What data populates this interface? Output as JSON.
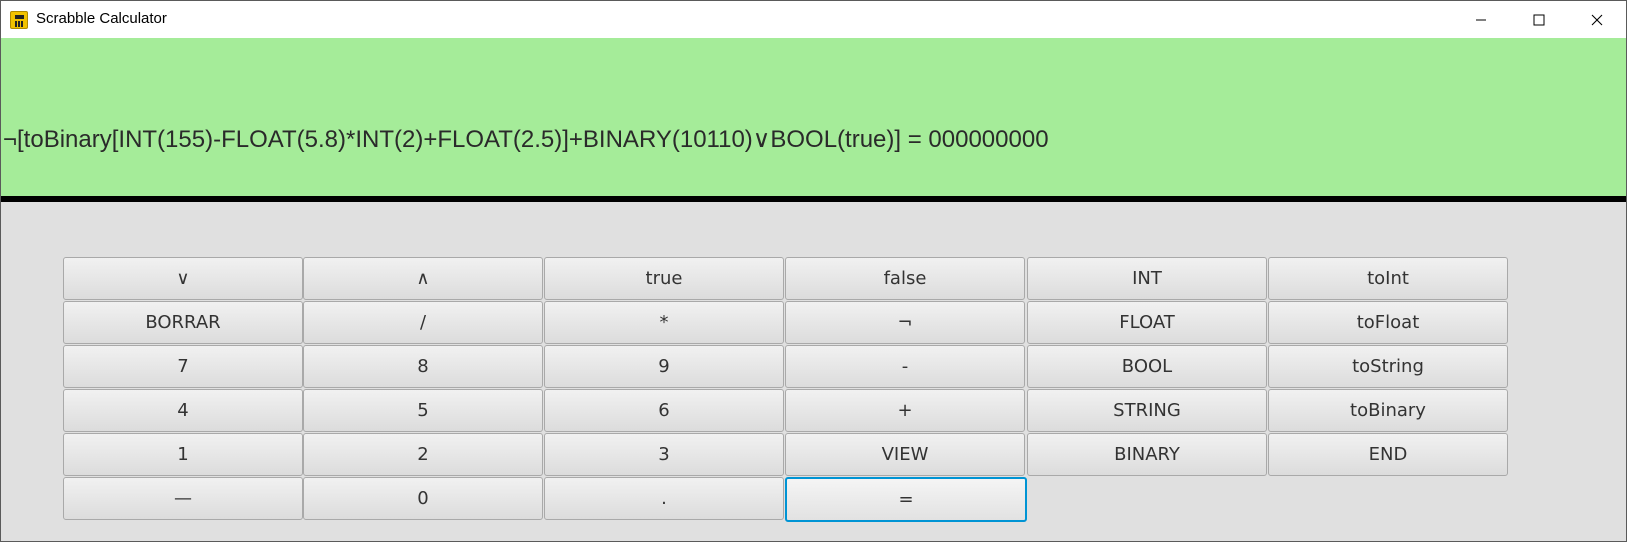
{
  "window": {
    "title": "Scrabble Calculator",
    "icon": "calculator-icon"
  },
  "controls": {
    "minimize_icon": "minimize-icon",
    "maximize_icon": "maximize-icon",
    "close_icon": "close-icon"
  },
  "display": {
    "expression": "¬[toBinary[INT(155)-FLOAT(5.8)*INT(2)+FLOAT(2.5)]+BINARY(10110)∨BOOL(true)] = 000000000",
    "background": "#a5ec99"
  },
  "keypad": {
    "rows": [
      [
        "∨",
        "∧",
        "true",
        "false",
        "INT",
        "toInt"
      ],
      [
        "BORRAR",
        "/",
        "*",
        "¬",
        "FLOAT",
        "toFloat"
      ],
      [
        "7",
        "8",
        "9",
        "-",
        "BOOL",
        "toString"
      ],
      [
        "4",
        "5",
        "6",
        "+",
        "STRING",
        "toBinary"
      ],
      [
        "1",
        "2",
        "3",
        "VIEW",
        "BINARY",
        "END"
      ],
      [
        "—",
        "0",
        ".",
        "="
      ]
    ],
    "focused_key": "=",
    "focus_color": "#0094d4"
  }
}
